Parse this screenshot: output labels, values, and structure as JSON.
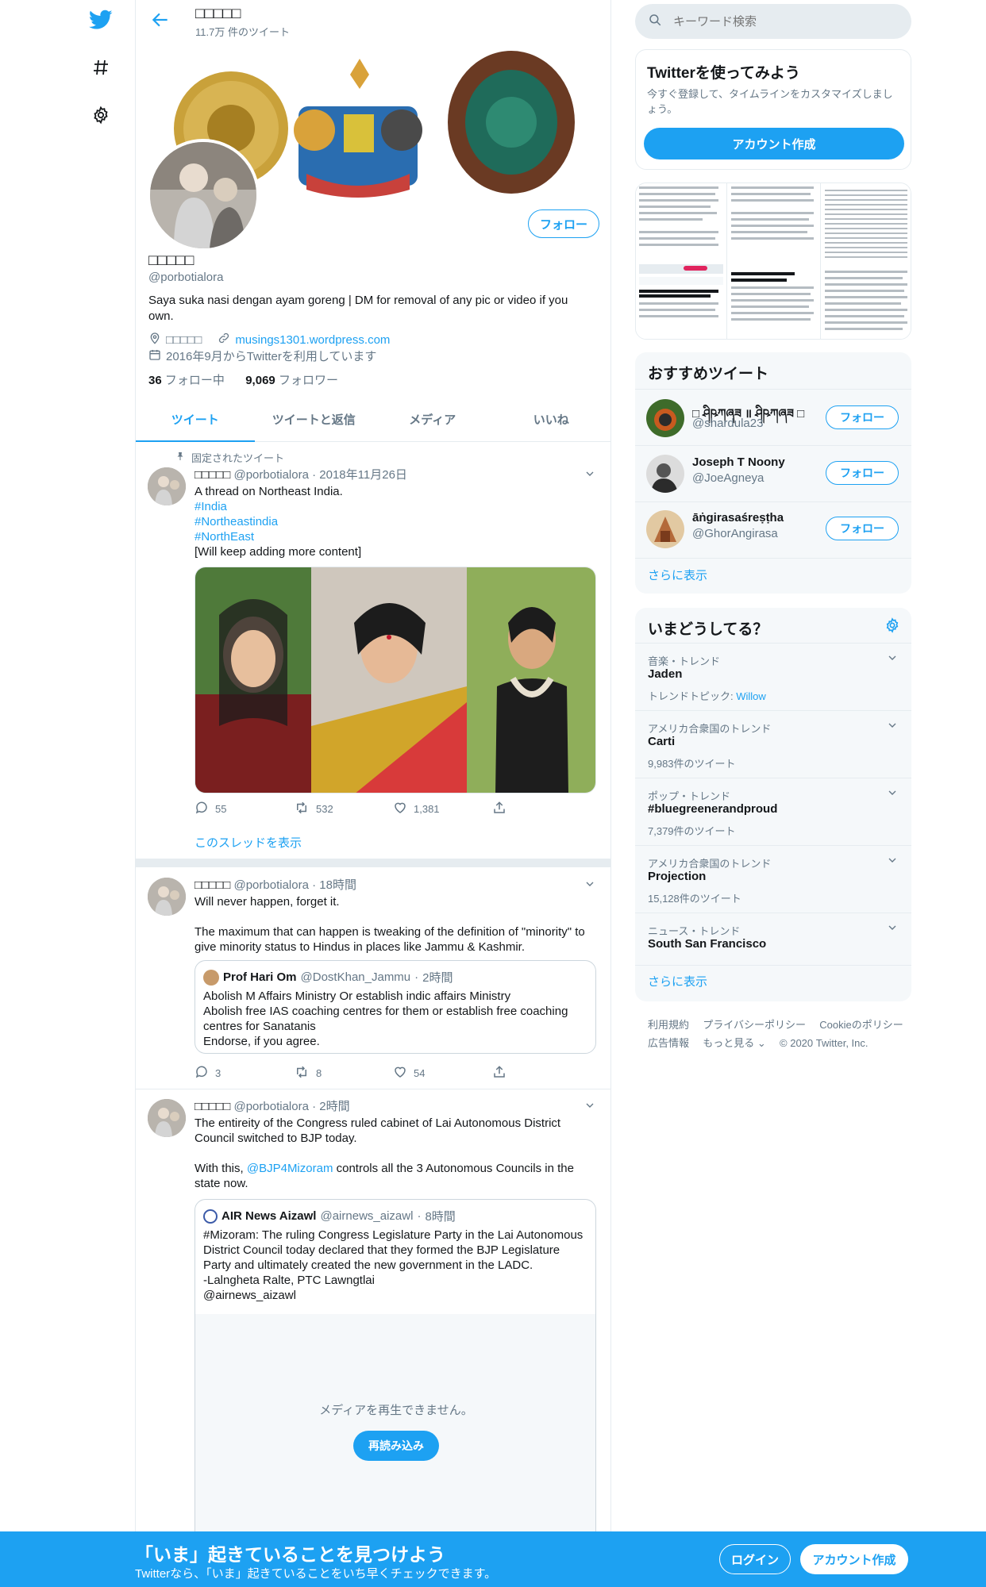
{
  "topbar": {
    "name": "□□□□□",
    "tweet_count": "11.7万 件のツイート"
  },
  "profile": {
    "name": "□□□□□",
    "handle": "@porbotialora",
    "follow_label": "フォロー",
    "bio": "Saya suka nasi dengan ayam goreng | DM for removal of any pic or video if you own.",
    "location": "□□□□□",
    "website": "musings1301.wordpress.com",
    "joined": "2016年9月からTwitterを利用しています",
    "following_count": "36",
    "following_label": "フォロー中",
    "followers_count": "9,069",
    "followers_label": "フォロワー"
  },
  "tabs": [
    "ツイート",
    "ツイートと返信",
    "メディア",
    "いいね"
  ],
  "tweets": [
    {
      "pinned_label": "固定されたツイート",
      "name": "□□□□□",
      "handle": "@porbotialora",
      "time": "2018年11月26日",
      "text_line1": "A thread on Northeast India.",
      "tag1": "#India",
      "tag2": "#Northeastindia",
      "tag3": "#NorthEast",
      "text_line2": "[Will keep adding more content]",
      "replies": "55",
      "retweets": "532",
      "likes": "1,381",
      "thread_link": "このスレッドを表示"
    },
    {
      "name": "□□□□□",
      "handle": "@porbotialora",
      "time": "18時間",
      "text_p1": "Will never happen, forget it.",
      "text_p2": "The maximum that can happen is tweaking of the definition of \"minority\" to give minority status to Hindus in places like Jammu & Kashmir.",
      "quote": {
        "name": "Prof Hari Om",
        "handle": "@DostKhan_Jammu",
        "time": "2時間",
        "line1": "Abolish M Affairs Ministry Or establish indic affairs Ministry",
        "line2": "Abolish free IAS coaching centres for them or establish free coaching centres for Sanatanis",
        "line3": "Endorse, if you agree."
      },
      "replies": "3",
      "retweets": "8",
      "likes": "54"
    },
    {
      "name": "□□□□□",
      "handle": "@porbotialora",
      "time": "2時間",
      "text_p1": "The entireity of the Congress ruled cabinet of Lai Autonomous District Council switched to BJP today.",
      "text_p2_a": "With this, ",
      "text_p2_link": "@BJP4Mizoram",
      "text_p2_b": " controls all the 3 Autonomous Councils in the state now.",
      "quote": {
        "name": "AIR News Aizawl",
        "handle": "@airnews_aizawl",
        "time": "8時間",
        "line1": "#Mizoram: The ruling Congress Legislature Party in the Lai Autonomous District Council today declared that they formed the BJP Legislature Party and ultimately created the new government in the LADC.",
        "line2": "-Lalngheta Ralte, PTC Lawngtlai",
        "line3": "@airnews_aizawl",
        "media_error": "メディアを再生できません。",
        "reload_label": "再読み込み"
      }
    }
  ],
  "right": {
    "search_placeholder": "キーワード検索",
    "signup_card": {
      "title": "Twitterを使ってみよう",
      "desc": "今すぐ登録して、タイムラインをカスタマイズしましょう。",
      "button": "アカウント作成"
    },
    "who_to_follow": {
      "title": "おすすめツイート",
      "users": [
        {
          "name": "□ ཤིཥཀཞཟ ॥ ཤིཥཀཞཟ □",
          "handle": "@shardula23",
          "button": "フォロー"
        },
        {
          "name": "Joseph T Noony",
          "handle": "@JoeAgneya",
          "button": "フォロー"
        },
        {
          "name": "āṅgirasaśreṣṭha",
          "handle": "@GhorAngirasa",
          "button": "フォロー"
        }
      ],
      "more": "さらに表示"
    },
    "trends": {
      "title": "いまどうしてる？",
      "items": [
        {
          "meta": "音楽・トレンド",
          "title": "Jaden",
          "sub_label": "トレンドトピック: ",
          "sub_link": "Willow"
        },
        {
          "meta": "アメリカ合衆国のトレンド",
          "title": "Carti",
          "sub_label": "9,983件のツイート",
          "sub_link": ""
        },
        {
          "meta": "ポップ・トレンド",
          "title": "#bluegreenerandproud",
          "sub_label": "7,379件のツイート",
          "sub_link": ""
        },
        {
          "meta": "アメリカ合衆国のトレンド",
          "title": "Projection",
          "sub_label": "15,128件のツイート",
          "sub_link": ""
        },
        {
          "meta": "ニュース・トレンド",
          "title": "South San Francisco",
          "sub_label": "",
          "sub_link": ""
        }
      ],
      "more": "さらに表示"
    },
    "footer": {
      "links1": [
        "利用規約",
        "プライバシーポリシー",
        "Cookieのポリシー"
      ],
      "links2": [
        "広告情報",
        "もっと見る ⌄"
      ],
      "copyright": "© 2020 Twitter, Inc."
    }
  },
  "bottom_bar": {
    "headline": "「いま」起きていることを見つけよう",
    "sub": "Twitterなら、「いま」起きていることをいち早くチェックできます。",
    "login": "ログイン",
    "signup": "アカウント作成"
  },
  "colors": {
    "accent": "#1da1f2",
    "text": "#14171a",
    "muted": "#657786",
    "border": "#e6ecf0",
    "panel": "#f5f8fa"
  }
}
